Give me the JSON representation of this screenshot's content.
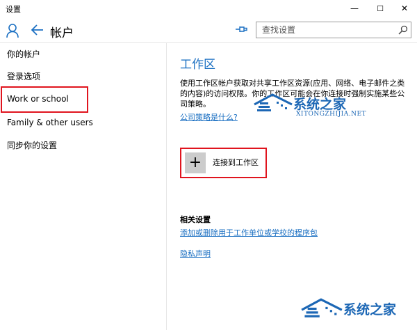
{
  "window": {
    "title": "设置",
    "minimize": "—",
    "maximize": "☐",
    "close": "✕"
  },
  "header": {
    "title": "帐户",
    "search_placeholder": "查找设置"
  },
  "sidebar": {
    "items": [
      {
        "label": "你的帐户"
      },
      {
        "label": "登录选项"
      },
      {
        "label": "Work or school"
      },
      {
        "label": "Family & other users"
      },
      {
        "label": "同步你的设置"
      }
    ]
  },
  "main": {
    "title": "工作区",
    "description": "使用工作区帐户获取对共享工作区资源(应用、网络、电子邮件之类的内容)的访问权限。你的工作区可能会在你连接时强制实施某些公司策略。",
    "policy_link": "公司策略是什么?",
    "connect_plus": "+",
    "connect_label": "连接到工作区",
    "related_title": "相关设置",
    "related_links": [
      "添加或删除用于工作单位或学校的程序包",
      "隐私声明"
    ]
  },
  "watermarks": [
    {
      "main": "系统之家",
      "sub": "XITONGZHIJIA.NET"
    },
    {
      "main": "系统之家"
    }
  ],
  "colors": {
    "accent": "#1a6fc2",
    "highlight": "#e0141e",
    "tile": "#cccccc"
  }
}
